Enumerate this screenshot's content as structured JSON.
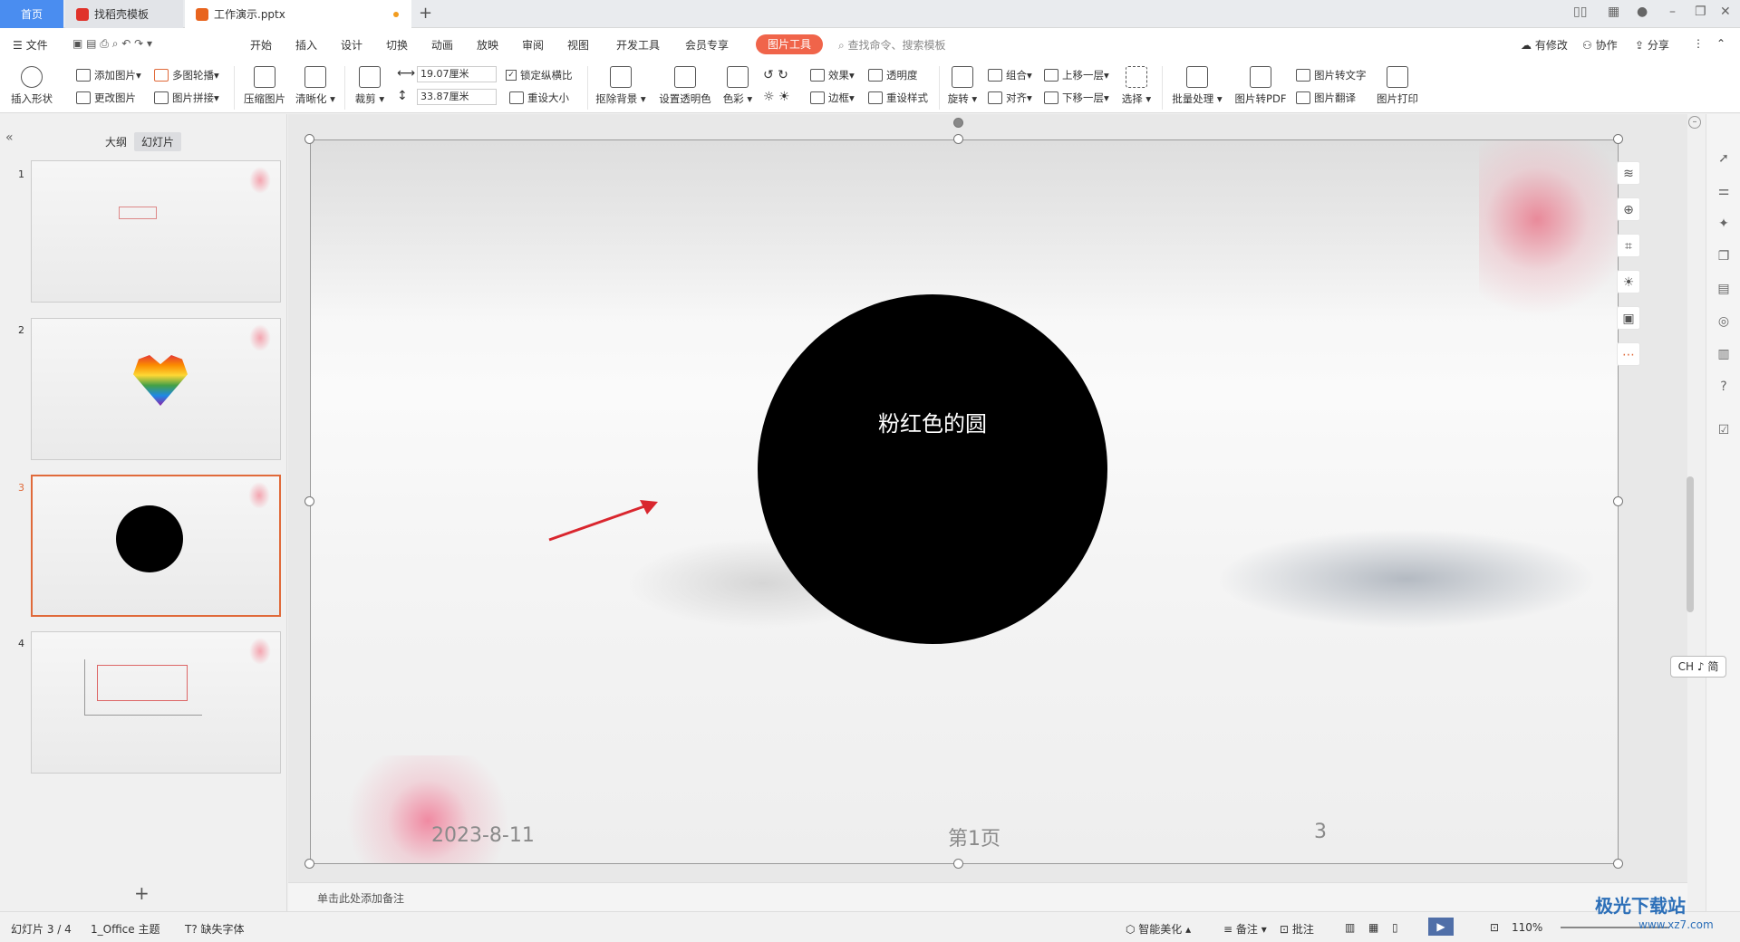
{
  "tabs": {
    "home": "首页",
    "template": "找稻壳模板",
    "doc": "工作演示.pptx",
    "new_tab": "+"
  },
  "menu": {
    "file": "文件",
    "items": [
      "开始",
      "插入",
      "设计",
      "切换",
      "动画",
      "放映",
      "审阅",
      "视图",
      "开发工具",
      "会员专享"
    ],
    "active": "图片工具",
    "search": "查找命令、搜索模板",
    "modified": "有修改",
    "collab": "协作",
    "share": "分享"
  },
  "ribbon": {
    "insert_shape": "插入形状",
    "add_image": "添加图片",
    "change_image": "更改图片",
    "multi_contour": "多图轮播",
    "image_collage": "图片拼接",
    "compress": "压缩图片",
    "sharpen": "清晰化",
    "crop": "裁剪",
    "width": "19.07厘米",
    "height": "33.87厘米",
    "lock_ratio": "锁定纵横比",
    "reset_size": "重设大小",
    "remove_bg": "抠除背景",
    "set_transparent": "设置透明色",
    "color": "色彩",
    "effect": "效果",
    "transparency": "透明度",
    "border": "边框",
    "reset_style": "重设样式",
    "rotate": "旋转",
    "group": "组合",
    "align": "对齐",
    "bring_forward": "上移一层",
    "send_backward": "下移一层",
    "select": "选择",
    "batch": "批量处理",
    "to_pdf": "图片转PDF",
    "to_text": "图片转文字",
    "translate": "图片翻译",
    "print": "图片打印"
  },
  "left_panel": {
    "tab_outline": "大纲",
    "tab_slides": "幻灯片",
    "thumbs": [
      {
        "num": "1"
      },
      {
        "num": "2"
      },
      {
        "num": "3"
      },
      {
        "num": "4"
      }
    ],
    "add_slide": "+",
    "collapse": "«"
  },
  "slide": {
    "circle_text": "粉红色的圆",
    "date": "2023-8-11",
    "page_label": "第1页",
    "page_num": "3",
    "circle_color": "#000000",
    "arrow_color": "#d9262e"
  },
  "notes": {
    "placeholder": "单击此处添加备注"
  },
  "status": {
    "slide_info": "幻灯片 3 / 4",
    "theme": "1_Office 主题",
    "missing_font": "缺失字体",
    "beautify": "智能美化",
    "notes": "备注",
    "comments": "批注",
    "zoom": "110%"
  },
  "ime": "CH ♪ 简",
  "watermark": {
    "brand": "极光下载站",
    "url": "www.xz7.com"
  }
}
